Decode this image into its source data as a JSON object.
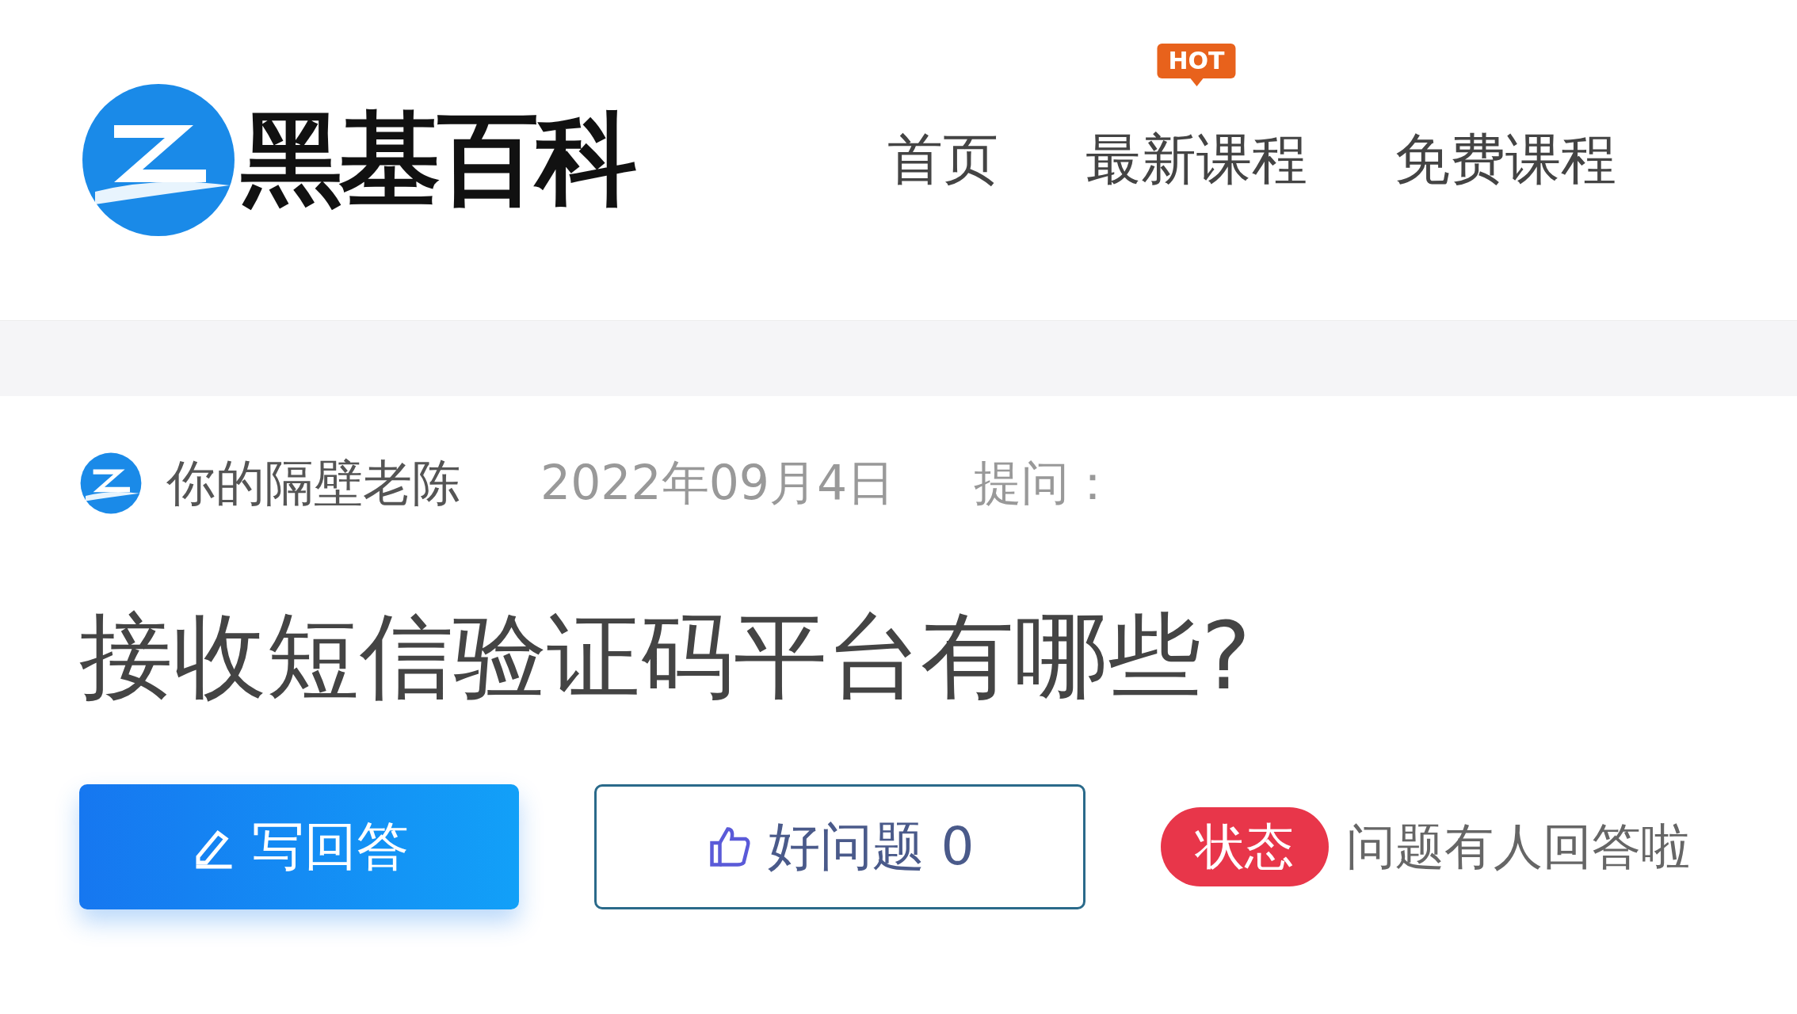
{
  "header": {
    "logo": {
      "text": "黑基百科"
    },
    "nav": [
      {
        "label": "首页"
      },
      {
        "label": "最新课程",
        "badge": "HOT"
      },
      {
        "label": "免费课程"
      }
    ]
  },
  "question": {
    "author": "你的隔壁老陈",
    "date": "2022年09月4日",
    "label": "提问：",
    "title": "接收短信验证码平台有哪些?",
    "actions": [
      {
        "kind": "primary",
        "label": "写回答"
      },
      {
        "kind": "outline",
        "label": "好问题 0"
      }
    ],
    "status": {
      "badge": "状态",
      "text": "问题有人回答啦"
    }
  }
}
